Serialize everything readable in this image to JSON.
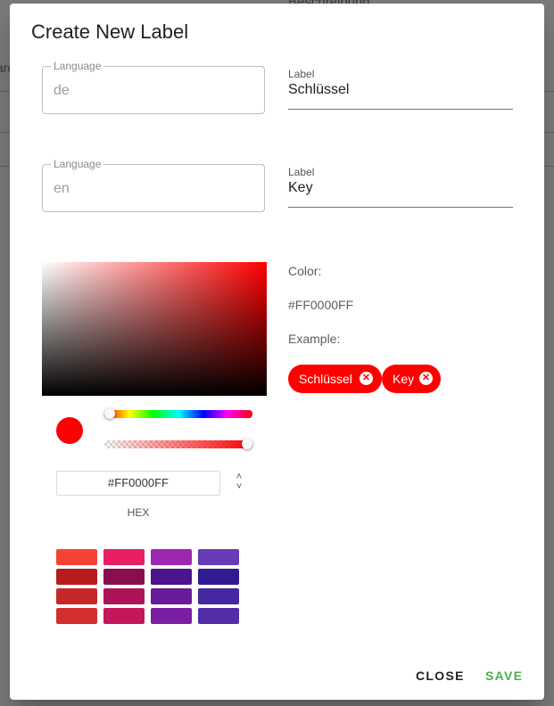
{
  "background": {
    "partial_text": "Beschreibung",
    "partial_text_left": "ard"
  },
  "dialog": {
    "title": "Create New Label",
    "rows": [
      {
        "language_label": "Language",
        "language_value": "de",
        "label_caption": "Label",
        "label_value": "Schlüssel"
      },
      {
        "language_label": "Language",
        "language_value": "en",
        "label_caption": "Label",
        "label_value": "Key"
      }
    ],
    "color_picker": {
      "hex_value": "#FF0000FF",
      "format_label": "HEX",
      "hue": 0.0,
      "alpha": 1.0,
      "preview_color": "#FF0000",
      "swatch_rows": [
        [
          "#F44336",
          "#E91E63",
          "#9C27B0",
          "#673AB7"
        ],
        [
          "#B71C1C",
          "#880E4F",
          "#4A148C",
          "#311B92"
        ],
        [
          "#C62828",
          "#AD1457",
          "#6A1B9A",
          "#4527A0"
        ],
        [
          "#D32F2F",
          "#C2185B",
          "#7B1FA2",
          "#512DA8"
        ],
        [
          "#E53935",
          "#D81B60",
          "#8E24AA",
          "#5E35B1"
        ]
      ]
    },
    "color_info": {
      "color_label": "Color:",
      "color_value": "#FF0000FF",
      "example_label": "Example:",
      "chips": [
        "Schlüssel",
        "Key"
      ],
      "chip_color": "#FF0000"
    },
    "actions": {
      "close": "CLOSE",
      "save": "SAVE",
      "save_color": "#4CAF50"
    }
  }
}
